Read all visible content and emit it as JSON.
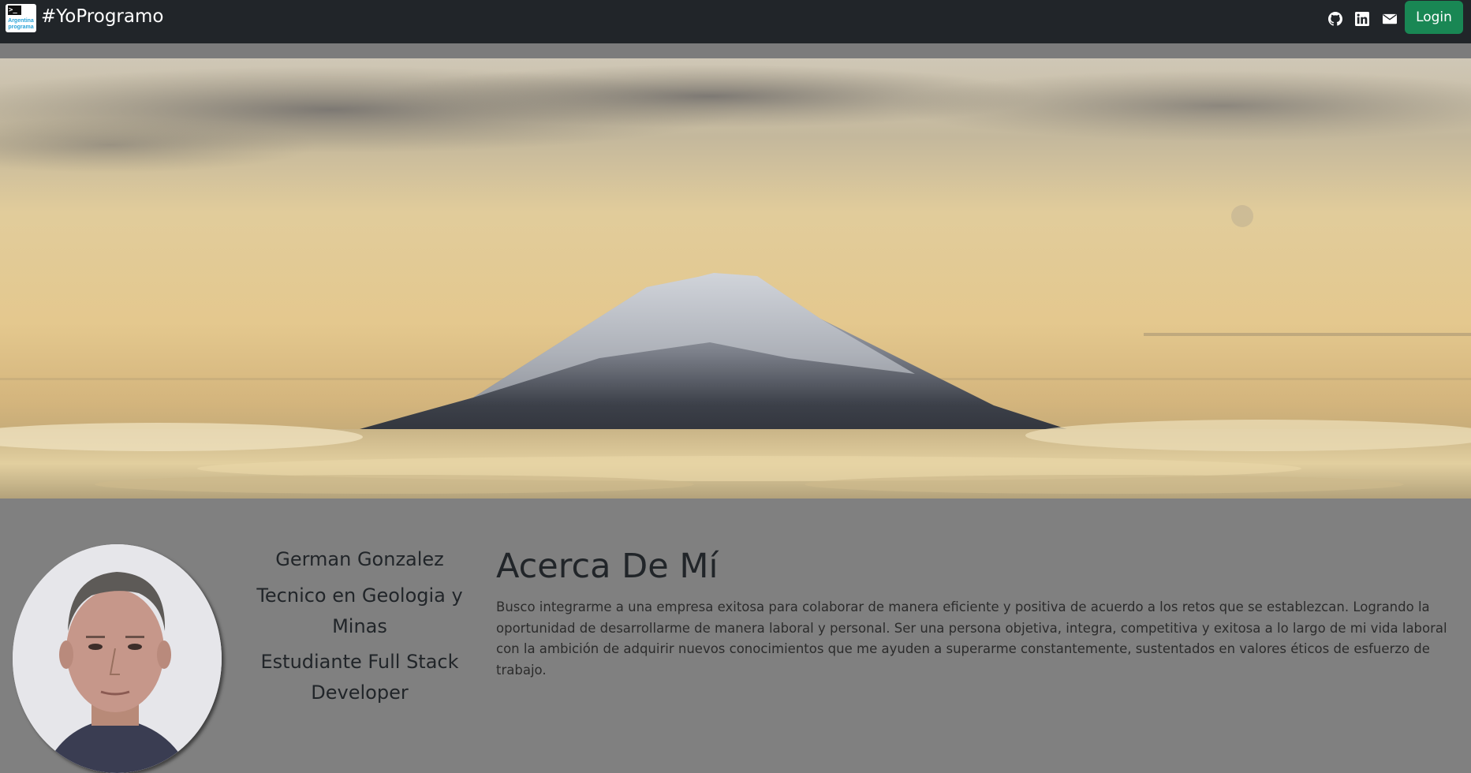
{
  "navbar": {
    "brand_logo_line1": "Argentina",
    "brand_logo_line2": "programa",
    "brand_title": "#YoProgramo",
    "icons": [
      "github-icon",
      "linkedin-icon",
      "envelope-icon"
    ],
    "login_label": "Login",
    "login_color": "#198754",
    "background": "#212529"
  },
  "hero": {
    "image_alt": "Mount Fuji above the clouds"
  },
  "profile": {
    "name": "German Gonzalez",
    "title_1": "Tecnico en Geologia y Minas",
    "title_2": "Estudiante Full Stack Developer"
  },
  "about": {
    "heading": "Acerca De Mí",
    "text": "Busco integrarme a una empresa exitosa para colaborar de manera eficiente y positiva de acuerdo a los retos que se establezcan. Logrando la oportunidad de desarrollarme de manera laboral y personal. Ser una persona objetiva, integra, competitiva y exitosa a lo largo de mi vida laboral con la ambición de adquirir nuevos conocimientos que me ayuden a superarme constantemente, sustentados en valores éticos de esfuerzo de trabajo."
  },
  "colors": {
    "page_background": "#808080",
    "text": "#212529"
  }
}
